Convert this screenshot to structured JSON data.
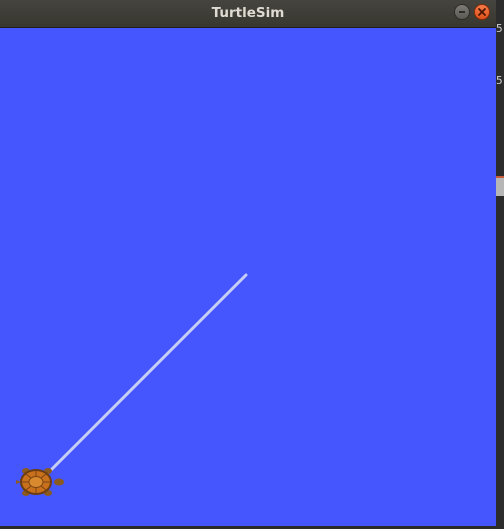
{
  "window": {
    "title": "TurtleSim"
  },
  "canvas": {
    "background_color": "#4556ff",
    "pen_color": "#c8cdf5",
    "turtle": {
      "icon": "turtle-icon",
      "shell_color": "#c8701c",
      "body_color": "#8a5a20"
    }
  },
  "controls": {
    "minimize_icon": "minimize-icon",
    "close_icon": "close-icon"
  },
  "background_window": {
    "fragments": [
      "5",
      "5"
    ]
  }
}
